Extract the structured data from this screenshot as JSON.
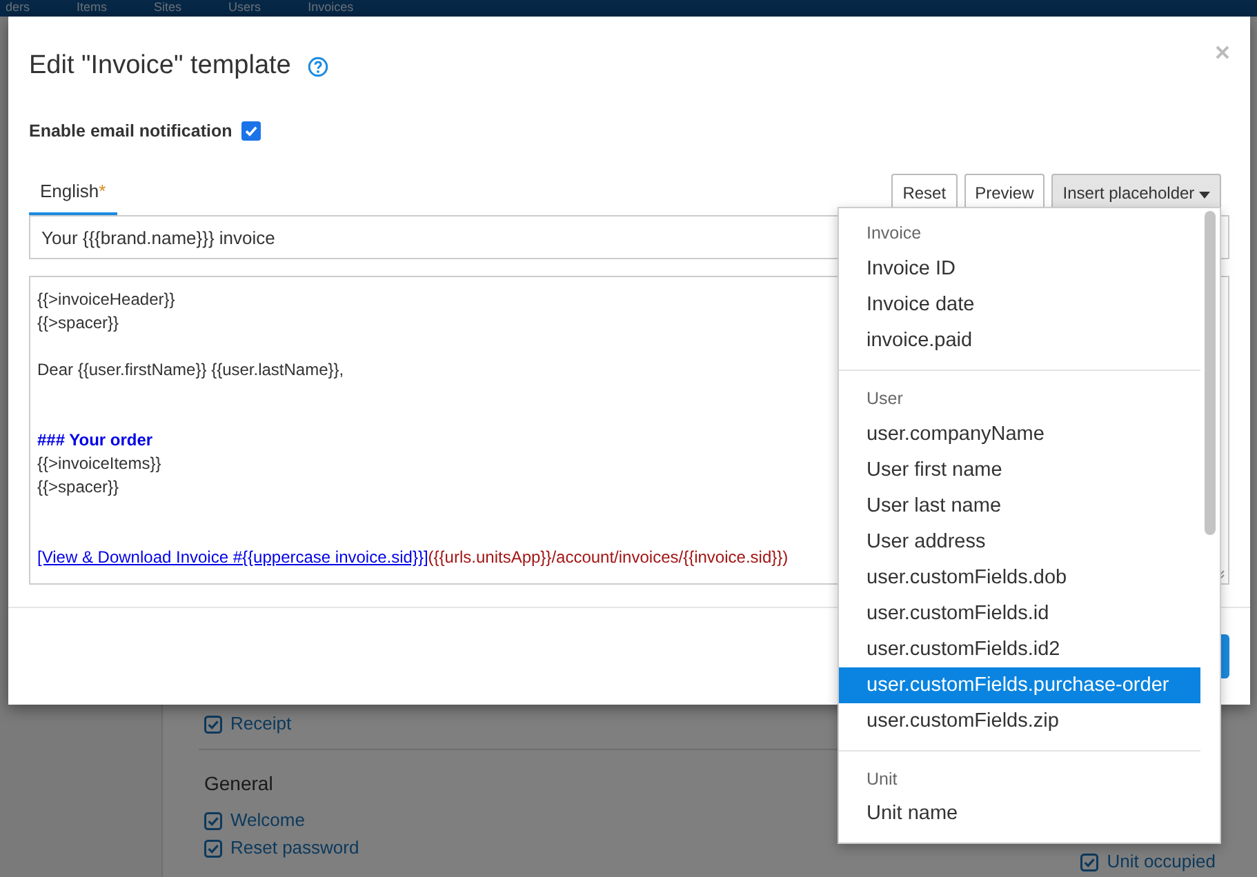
{
  "background": {
    "nav_items": [
      "ders",
      "Items",
      "Sites",
      "Users",
      "Invoices"
    ],
    "sections": [
      {
        "items": [
          {
            "label": "Receipt",
            "checked": true
          }
        ]
      },
      {
        "title": "General",
        "items": [
          {
            "label": "Welcome",
            "checked": true
          },
          {
            "label": "Reset password",
            "checked": true
          }
        ]
      }
    ],
    "side_option": {
      "label": "Unit occupied",
      "checked": true
    }
  },
  "modal": {
    "title": "Edit \"Invoice\" template",
    "email_notification": {
      "label": "Enable email notification",
      "checked": true
    },
    "tabs": [
      {
        "label": "English",
        "marker": "*",
        "selected": true
      }
    ],
    "buttons": [
      "Reset",
      "Preview"
    ],
    "insert_button": {
      "label": "Insert placeholder",
      "expanded": true
    },
    "subject": {
      "value": "Your {{{brand.name}}} invoice"
    },
    "body_lines": [
      {
        "kind": "plain",
        "text": "{{>invoiceHeader}}"
      },
      {
        "kind": "plain",
        "text": "{{>spacer}}"
      },
      {
        "kind": "blank"
      },
      {
        "kind": "plain",
        "text": "Dear {{user.firstName}} {{user.lastName}},"
      },
      {
        "kind": "blank"
      },
      {
        "kind": "blank"
      },
      {
        "kind": "heading",
        "text": "### Your order"
      },
      {
        "kind": "plain",
        "text": "{{>invoiceItems}}"
      },
      {
        "kind": "plain",
        "text": "{{>spacer}}"
      },
      {
        "kind": "blank"
      },
      {
        "kind": "blank"
      },
      {
        "kind": "link",
        "text": "[View & Download Invoice #{{uppercase invoice.sid}}]",
        "url": "({{urls.unitsApp}}/account/invoices/{{invoice.sid}})"
      }
    ]
  },
  "placeholder_menu": {
    "groups": [
      {
        "header": "Invoice",
        "items": [
          {
            "label": "Invoice ID",
            "selected": false
          },
          {
            "label": "Invoice date",
            "selected": false
          },
          {
            "label": "invoice.paid",
            "selected": false
          }
        ]
      },
      {
        "header": "User",
        "items": [
          {
            "label": "user.companyName",
            "selected": false
          },
          {
            "label": "User first name",
            "selected": false
          },
          {
            "label": "User last name",
            "selected": false
          },
          {
            "label": "User address",
            "selected": false
          },
          {
            "label": "user.customFields.dob",
            "selected": false
          },
          {
            "label": "user.customFields.id",
            "selected": false
          },
          {
            "label": "user.customFields.id2",
            "selected": false
          },
          {
            "label": "user.customFields.purchase-order",
            "selected": true
          },
          {
            "label": "user.customFields.zip",
            "selected": false
          }
        ]
      },
      {
        "header": "Unit",
        "items": [
          {
            "label": "Unit name",
            "selected": false
          }
        ]
      }
    ]
  }
}
